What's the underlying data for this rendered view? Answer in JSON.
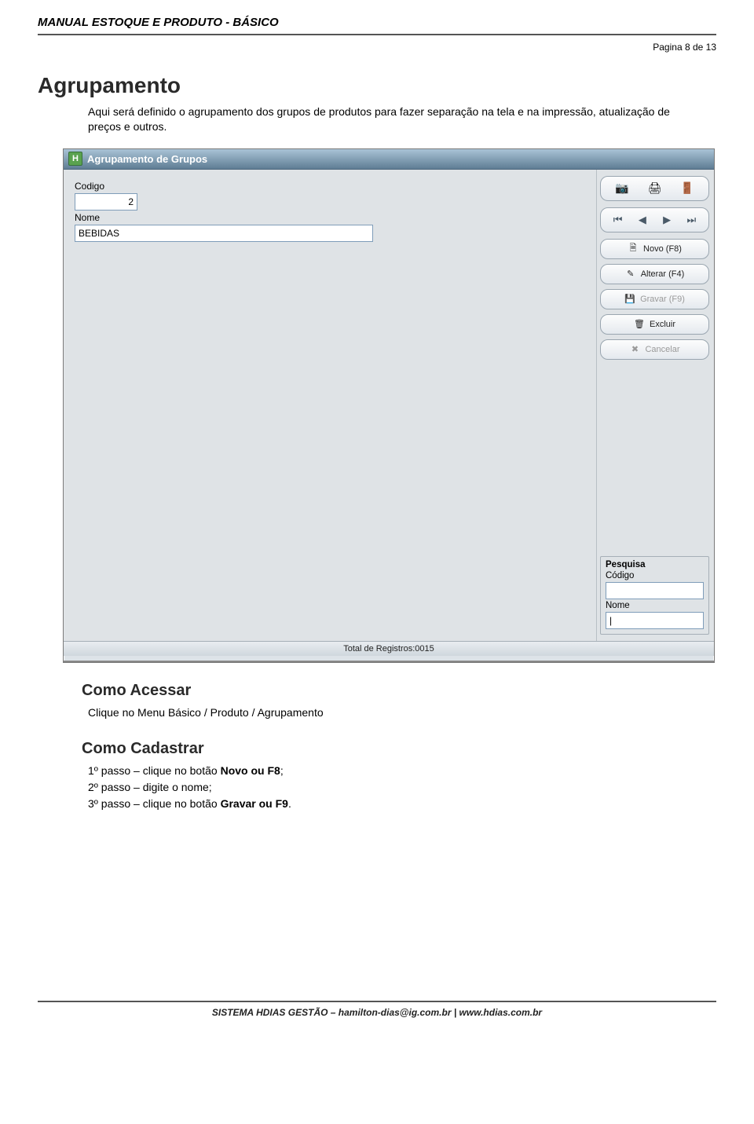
{
  "doc": {
    "title": "MANUAL ESTOQUE E PRODUTO - BÁSICO",
    "page_label": "Pagina 8 de 13",
    "section": "Agrupamento",
    "intro": "Aqui será definido o agrupamento dos grupos de produtos para fazer separação na tela e na impressão, atualização de preços e outros.",
    "access_h": "Como Acessar",
    "access_line": "Clique no Menu Básico / Produto / Agrupamento",
    "cadastrar_h": "Como Cadastrar",
    "step1_prefix": "1º passo – clique no botão ",
    "step1_bold": "Novo ou F8",
    "step1_suffix": ";",
    "step2": "2º passo – digite o nome;",
    "step3_prefix": "3º passo – clique no botão ",
    "step3_bold": "Gravar ou F9",
    "step3_suffix": ".",
    "footer": "SISTEMA HDIAS GESTÃO – hamilton-dias@ig.com.br | www.hdias.com.br"
  },
  "app": {
    "titlebar": "Agrupamento de Grupos",
    "labels": {
      "codigo": "Codigo",
      "nome": "Nome",
      "pesquisa": "Pesquisa",
      "p_codigo": "Código",
      "p_nome": "Nome"
    },
    "fields": {
      "codigo": "2",
      "nome": "BEBIDAS",
      "p_codigo": "",
      "p_nome": "|"
    },
    "buttons": {
      "novo": "Novo (F8)",
      "alterar": "Alterar (F4)",
      "gravar": "Gravar (F9)",
      "excluir": "Excluir",
      "cancelar": "Cancelar"
    },
    "statusbar": "Total de Registros:0015"
  }
}
